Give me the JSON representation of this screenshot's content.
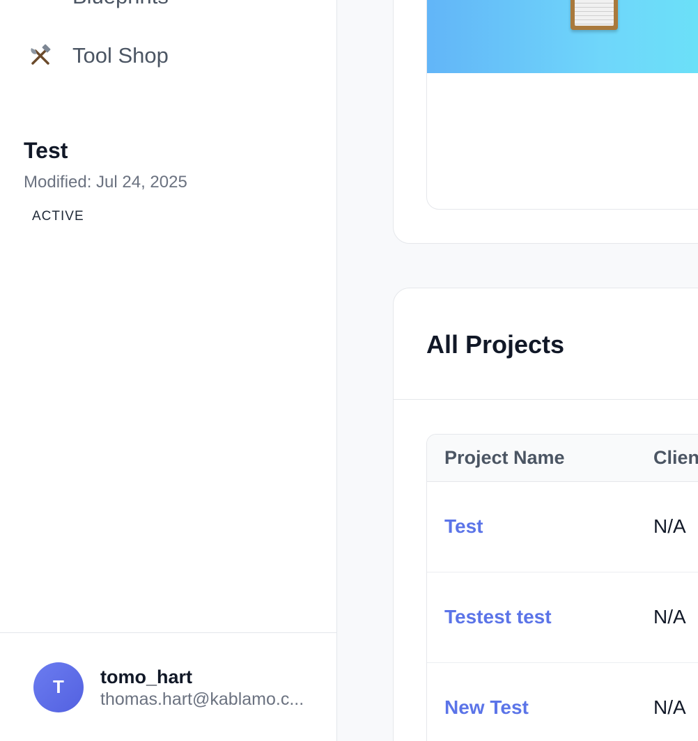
{
  "sidebar": {
    "items": [
      {
        "label": "Blueprints",
        "icon": "blueprints-icon"
      },
      {
        "label": "Tool Shop",
        "icon": "hammer-wrench-icon"
      }
    ],
    "user": {
      "initial": "T",
      "username": "tomo_hart",
      "email": "thomas.hart@kablamo.c..."
    }
  },
  "recent": {
    "card": {
      "title": "Test",
      "modified": "Modified: Jul 24, 2025",
      "status": "ACTIVE",
      "banner_colors": [
        "#62b5f8",
        "#6ae2f8"
      ]
    }
  },
  "all_projects": {
    "title": "All Projects",
    "columns": [
      "Project Name",
      "Client"
    ],
    "rows": [
      {
        "name": "Test",
        "client": "N/A"
      },
      {
        "name": "Testest test",
        "client": "N/A"
      },
      {
        "name": "New Test",
        "client": "N/A"
      }
    ]
  },
  "colors": {
    "accent": "#5b74e8",
    "avatar": "#5b6be6"
  }
}
